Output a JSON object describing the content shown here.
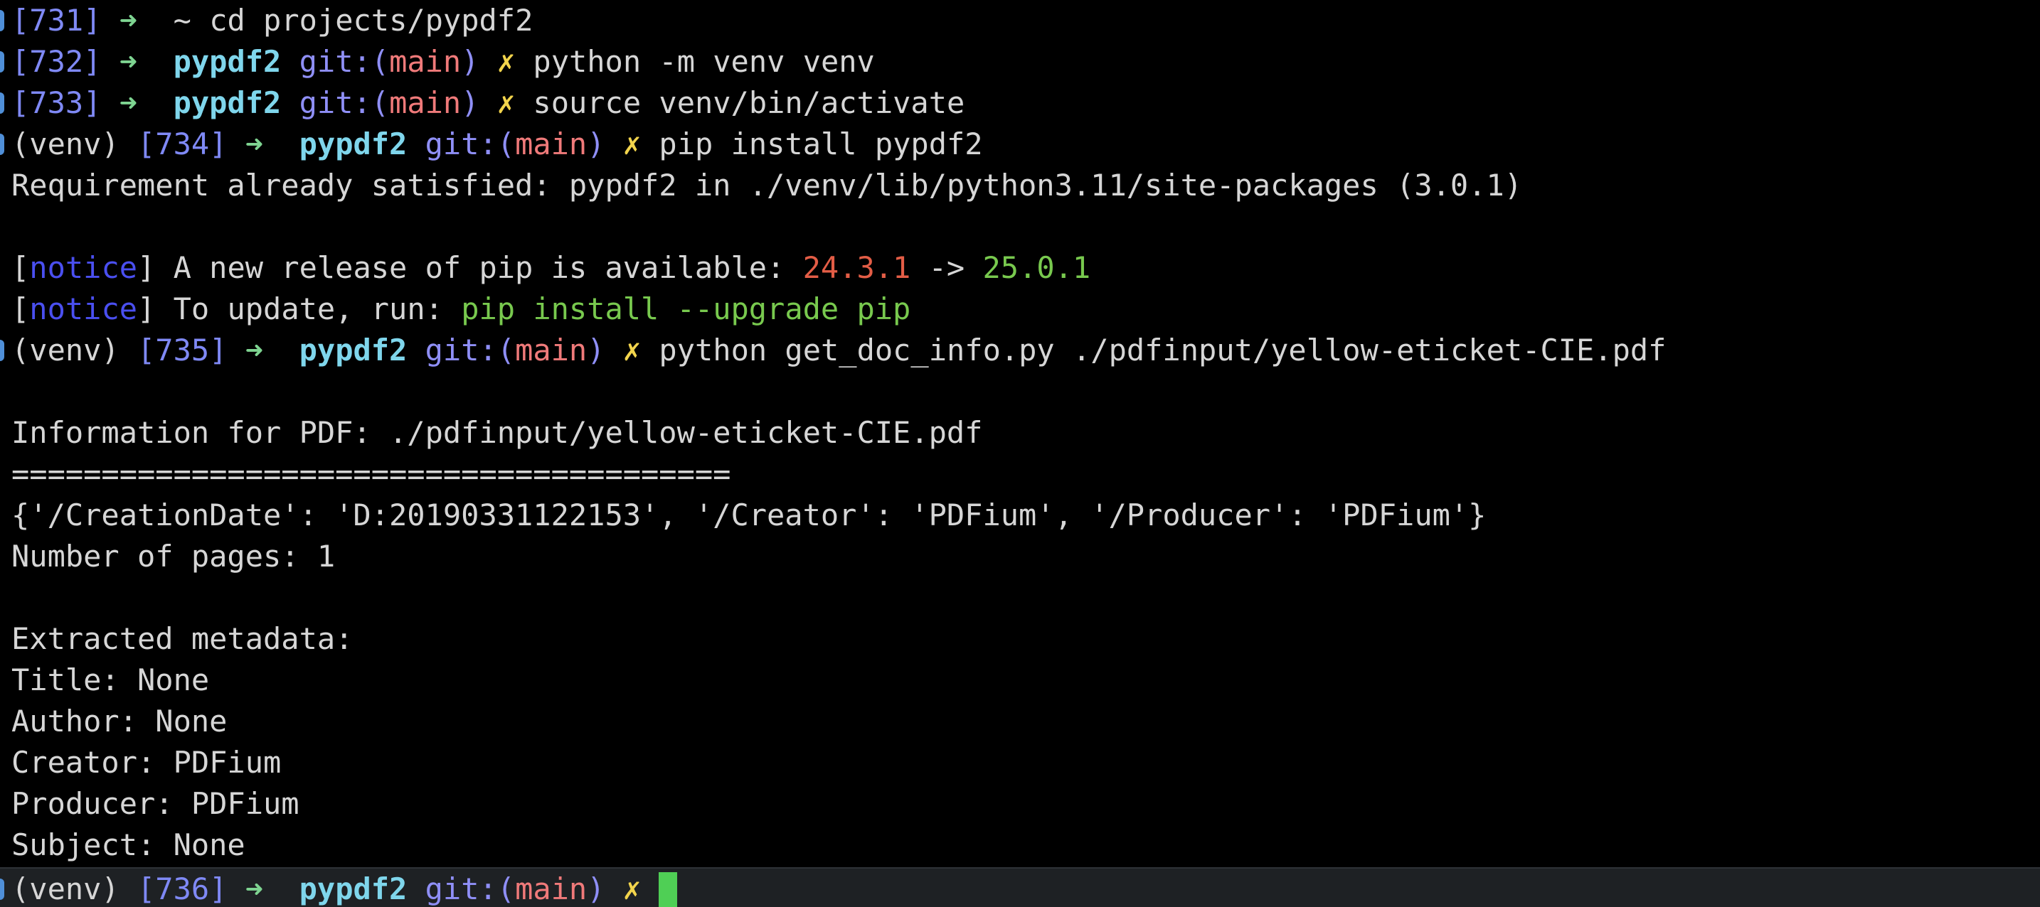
{
  "lines": {
    "l0": {
      "num": "[731]",
      "arrow": "➜",
      "dir": "~",
      "cmd": "cd projects/pypdf2"
    },
    "l1": {
      "num": "[732]",
      "arrow": "➜",
      "dir": "pypdf2",
      "git": "git:(",
      "branch": "main",
      "git_close": ")",
      "dirty": "✗",
      "cmd": "python -m venv venv"
    },
    "l2": {
      "num": "[733]",
      "arrow": "➜",
      "dir": "pypdf2",
      "git": "git:(",
      "branch": "main",
      "git_close": ")",
      "dirty": "✗",
      "cmd": "source venv/bin/activate"
    },
    "l3": {
      "venv": "(venv)",
      "num": "[734]",
      "arrow": "➜",
      "dir": "pypdf2",
      "git": "git:(",
      "branch": "main",
      "git_close": ")",
      "dirty": "✗",
      "cmd": "pip install pypdf2"
    },
    "l4": {
      "text": "Requirement already satisfied: pypdf2 in ./venv/lib/python3.11/site-packages (3.0.1)"
    },
    "l6": {
      "open": "[",
      "notice": "notice",
      "close": "]",
      "text": " A new release of pip is available: ",
      "old": "24.3.1",
      "sep": " -> ",
      "new": "25.0.1"
    },
    "l7": {
      "open": "[",
      "notice": "notice",
      "close": "]",
      "text": " To update, run: ",
      "upgrade": "pip install --upgrade pip"
    },
    "l8": {
      "venv": "(venv)",
      "num": "[735]",
      "arrow": "➜",
      "dir": "pypdf2",
      "git": "git:(",
      "branch": "main",
      "git_close": ")",
      "dirty": "✗",
      "cmd": "python get_doc_info.py ./pdfinput/yellow-eticket-CIE.pdf"
    },
    "l10": {
      "text": "Information for PDF: ./pdfinput/yellow-eticket-CIE.pdf"
    },
    "l11": {
      "text": "========================================"
    },
    "l12": {
      "text": "{'/CreationDate': 'D:20190331122153', '/Creator': 'PDFium', '/Producer': 'PDFium'}"
    },
    "l13": {
      "text": "Number of pages: 1"
    },
    "l15": {
      "text": "Extracted metadata:"
    },
    "l16": {
      "text": "Title: None"
    },
    "l17": {
      "text": "Author: None"
    },
    "l18": {
      "text": "Creator: PDFium"
    },
    "l19": {
      "text": "Producer: PDFium"
    },
    "l20": {
      "text": "Subject: None"
    },
    "l21": {
      "venv": "(venv)",
      "num": "[736]",
      "arrow": "➜",
      "dir": "pypdf2",
      "git": "git:(",
      "branch": "main",
      "git_close": ")",
      "dirty": "✗"
    }
  },
  "colors": {
    "background": "#000000",
    "text": "#d6d6d6",
    "history_number": "#7f89f5",
    "arrow": "#7ed491",
    "directory": "#7fd6ec",
    "git": "#8f8ff7",
    "branch": "#f07a7a",
    "dirty_mark": "#f2d44c",
    "notice": "#4a4ff0",
    "old_version": "#e35d46",
    "new_version": "#78c94e",
    "cursor": "#4fcf55"
  }
}
